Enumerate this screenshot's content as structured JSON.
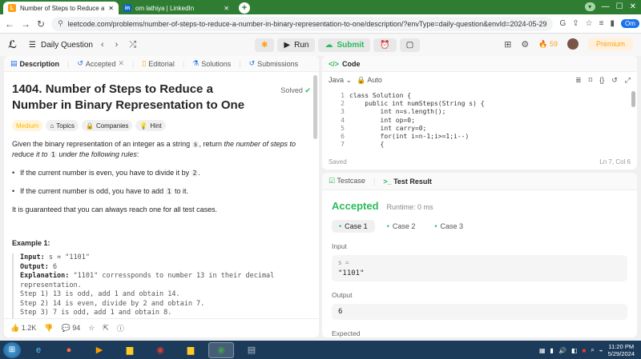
{
  "browser": {
    "tabs": [
      {
        "title": "Number of Steps to Reduce a Nu",
        "active": true
      },
      {
        "title": "om lathiya | LinkedIn",
        "active": false
      }
    ],
    "profile_badge": "",
    "url": "leetcode.com/problems/number-of-steps-to-reduce-a-number-in-binary-representation-to-one/description/?envType=daily-question&envId=2024-05-29",
    "account_label": "Om"
  },
  "topbar": {
    "daily_label": "Daily Question",
    "run_label": "Run",
    "submit_label": "Submit",
    "streak": "59",
    "premium_label": "Premium"
  },
  "left_tabs": [
    {
      "label": "Description",
      "icon": "document-icon"
    },
    {
      "label": "Accepted",
      "icon": "history-icon"
    },
    {
      "label": "Editorial",
      "icon": "book-icon"
    },
    {
      "label": "Solutions",
      "icon": "flask-icon"
    },
    {
      "label": "Submissions",
      "icon": "history-icon"
    }
  ],
  "problem": {
    "title": "1404. Number of Steps to Reduce a Number in Binary Representation to One",
    "status": "Solved",
    "badges": [
      "Medium",
      "Topics",
      "Companies",
      "Hint"
    ],
    "intro_a": "Given the binary representation of an integer as a string ",
    "intro_s": "s",
    "intro_b": ", return ",
    "intro_c": "the number of steps to reduce it to ",
    "intro_one": "1",
    "intro_d": " under the following rules",
    "intro_e": ":",
    "rule1_a": "If the current number is even, you have to divide it by ",
    "rule1_b": "2",
    "rule1_c": ".",
    "rule2_a": "If the current number is odd, you have to add ",
    "rule2_b": "1",
    "rule2_c": " to it.",
    "guarantee": "It is guaranteed that you can always reach one for all test cases.",
    "example_heading": "Example 1:",
    "ex_input_label": "Input:",
    "ex_input_val": " s = \"1101\"",
    "ex_output_label": "Output:",
    "ex_output_val": " 6",
    "ex_expl_label": "Explanation:",
    "ex_expl_val": " \"1101\" corressponds to number 13 in their decimal",
    "ex_expl_cont": "representation.",
    "ex_step1": "Step 1) 13 is odd, add 1 and obtain 14.",
    "ex_step2": "Step 2) 14 is even, divide by 2 and obtain 7.",
    "ex_step3": "Step 3) 7 is odd, add 1 and obtain 8."
  },
  "left_footer": {
    "likes": "1.2K",
    "comments": "94"
  },
  "code": {
    "panel_title": "Code",
    "language": "Java",
    "mode": "Auto",
    "saved": "Saved",
    "cursor": "Ln 7, Col 6",
    "lines": [
      {
        "n": "1",
        "text": "class Solution {"
      },
      {
        "n": "2",
        "text": "    public int numSteps(String s) {"
      },
      {
        "n": "3",
        "text": "        int n=s.length();"
      },
      {
        "n": "4",
        "text": "        int op=0;"
      },
      {
        "n": "5",
        "text": "        int carry=0;"
      },
      {
        "n": "6",
        "text": "        for(int i=n-1;i>=1;i--)"
      },
      {
        "n": "7",
        "text": "        {"
      }
    ]
  },
  "result": {
    "testcase_tab": "Testcase",
    "result_tab": "Test Result",
    "status": "Accepted",
    "runtime": "Runtime: 0 ms",
    "cases": [
      "Case 1",
      "Case 2",
      "Case 3"
    ],
    "input_label": "Input",
    "input_var": "s =",
    "input_val": "\"1101\"",
    "output_label": "Output",
    "output_val": "6",
    "expected_label": "Expected"
  },
  "taskbar": {
    "time": "11:20 PM",
    "date": "5/29/2024"
  }
}
